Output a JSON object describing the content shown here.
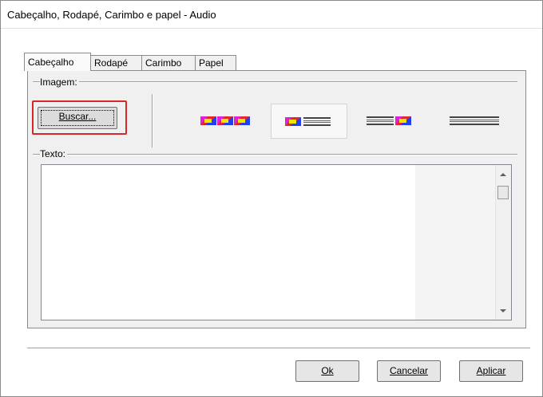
{
  "window": {
    "title": "Cabeçalho, Rodapé, Carimbo e papel - Audio"
  },
  "tabs": [
    {
      "label": "Cabeçalho",
      "active": true
    },
    {
      "label": "Rodapé",
      "active": false
    },
    {
      "label": "Carimbo",
      "active": false
    },
    {
      "label": "Papel",
      "active": false
    }
  ],
  "image_group": {
    "label": "Imagem:",
    "browse_button": "Buscar...",
    "positions": [
      {
        "name": "images-only",
        "selected": false
      },
      {
        "name": "image-left-text-right",
        "selected": true
      },
      {
        "name": "text-left-image-right",
        "selected": false
      },
      {
        "name": "text-only",
        "selected": false
      }
    ]
  },
  "text_group": {
    "label": "Texto:",
    "value": ""
  },
  "buttons": {
    "ok": "Ok",
    "cancel": "Cancelar",
    "apply": "Aplicar"
  },
  "colors": {
    "highlight": "#d6282a",
    "stripe_red": "#e0282a",
    "stripe_yellow": "#f2e400",
    "stripe_magenta": "#e020d8",
    "stripe_blue": "#2040f0"
  }
}
